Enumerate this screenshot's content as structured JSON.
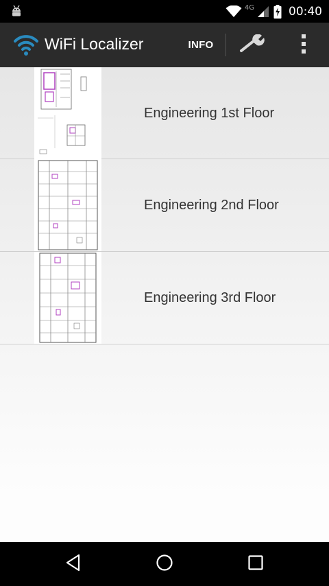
{
  "status_bar": {
    "time": "00:40",
    "network_type": "4G",
    "icons": [
      "android-icon",
      "wifi-icon",
      "signal-icon",
      "battery-charging-icon"
    ]
  },
  "action_bar": {
    "title": "WiFi Localizer",
    "info_label": "INFO",
    "icons": [
      "wifi-app-icon",
      "wrench-icon",
      "overflow-menu-icon"
    ]
  },
  "floors": [
    {
      "label": "Engineering 1st Floor"
    },
    {
      "label": "Engineering 2nd Floor"
    },
    {
      "label": "Engineering 3rd Floor"
    }
  ],
  "nav_bar": {
    "icons": [
      "back-icon",
      "home-icon",
      "recents-icon"
    ]
  }
}
